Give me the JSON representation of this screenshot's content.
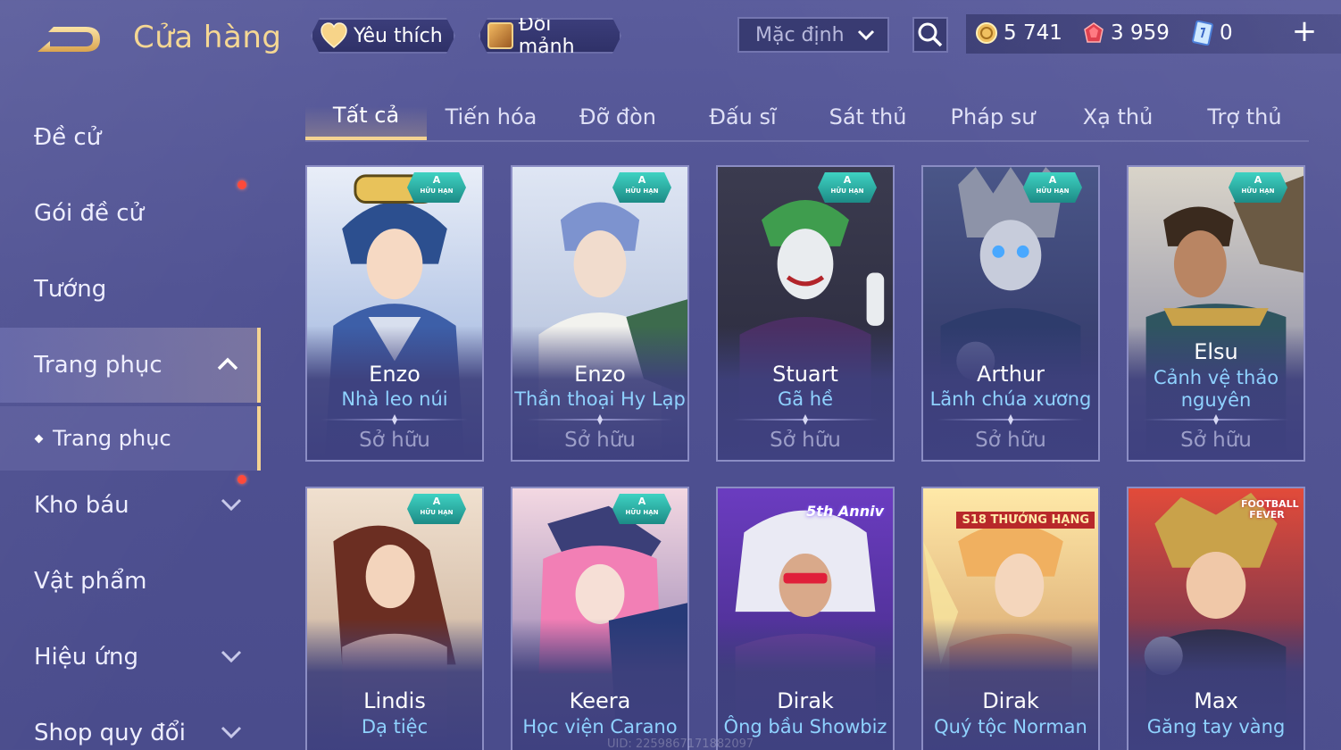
{
  "header": {
    "title": "Cửa hàng",
    "favorite_label": "Yêu thích",
    "shard_label": "Đổi mảnh",
    "sort_value": "Mặc định",
    "currencies": {
      "gold": "5 741",
      "ruby": "3 959",
      "voucher": "0"
    },
    "add_label": "+"
  },
  "sidebar": {
    "items": [
      {
        "label": "Đề cử"
      },
      {
        "label": "Gói đề cử"
      },
      {
        "label": "Tướng"
      },
      {
        "label": "Trang phục"
      },
      {
        "label": "Trang phục"
      },
      {
        "label": "Kho báu"
      },
      {
        "label": "Vật phẩm"
      },
      {
        "label": "Hiệu ứng"
      },
      {
        "label": "Shop quy đổi"
      }
    ]
  },
  "tabs": [
    {
      "label": "Tất cả"
    },
    {
      "label": "Tiến hóa"
    },
    {
      "label": "Đỡ đòn"
    },
    {
      "label": "Đấu sĩ"
    },
    {
      "label": "Sát thủ"
    },
    {
      "label": "Pháp sư"
    },
    {
      "label": "Xạ thủ"
    },
    {
      "label": "Trợ thủ"
    }
  ],
  "cards": [
    {
      "hero": "Enzo",
      "skin": "Nhà leo núi",
      "status": "Sở hữu",
      "badge": "A",
      "badge_sub": "HỮU HẠN"
    },
    {
      "hero": "Enzo",
      "skin": "Thần thoại Hy Lạp",
      "status": "Sở hữu",
      "badge": "A",
      "badge_sub": "HỮU HẠN"
    },
    {
      "hero": "Stuart",
      "skin": "Gã hề",
      "status": "Sở hữu",
      "badge": "A",
      "badge_sub": "HỮU HẠN"
    },
    {
      "hero": "Arthur",
      "skin": "Lãnh chúa xương",
      "status": "Sở hữu",
      "badge": "A",
      "badge_sub": "HỮU HẠN"
    },
    {
      "hero": "Elsu",
      "skin": "Cảnh vệ thảo nguyên",
      "status": "Sở hữu",
      "badge": "A",
      "badge_sub": "HỮU HẠN"
    },
    {
      "hero": "Lindis",
      "skin": "Dạ tiệc",
      "badge": "A",
      "badge_sub": "HỮU HẠN"
    },
    {
      "hero": "Keera",
      "skin": "Học viện Carano",
      "badge": "A",
      "badge_sub": "HỮU HẠN"
    },
    {
      "hero": "Dirak",
      "skin": "Ông bầu Showbiz",
      "badge_text": "5th Anniv"
    },
    {
      "hero": "Dirak",
      "skin": "Quý tộc Norman",
      "badge_text": "S18 THƯỞNG HẠNG"
    },
    {
      "hero": "Max",
      "skin": "Găng tay vàng",
      "badge_text": "FOOTBALL FEVER"
    }
  ],
  "footer": {
    "uid_text": "UID: 2259867171882097"
  },
  "colors": {
    "accent_gold": "#f4d392",
    "skin_name": "#8fd2ff",
    "status": "#9c9ec8",
    "badge_teal": "#3fd2c2",
    "notify_red": "#ff4a3a"
  }
}
